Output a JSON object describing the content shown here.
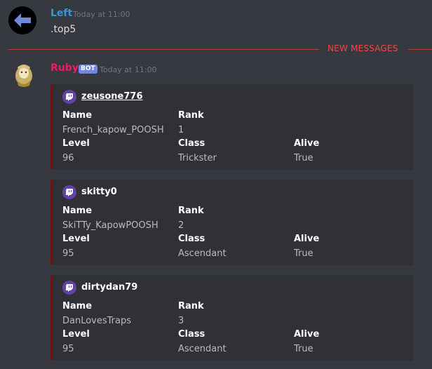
{
  "message1": {
    "author": "Left",
    "timestamp": "Today at 11:00",
    "content": ".top5",
    "author_color": "#3498db"
  },
  "divider": {
    "label": "NEW MESSAGES",
    "color": "#f04747"
  },
  "message2": {
    "author": "Ruby",
    "author_color": "#e91e63",
    "bot_tag": "BOT",
    "timestamp": "Today at 11:00"
  },
  "embeds": [
    {
      "author": "zeusone776",
      "fields": {
        "name_label": "Name",
        "name_value": "French_kapow_POOSH",
        "rank_label": "Rank",
        "rank_value": "1",
        "level_label": "Level",
        "level_value": "96",
        "class_label": "Class",
        "class_value": "Trickster",
        "alive_label": "Alive",
        "alive_value": "True"
      }
    },
    {
      "author": "skitty0",
      "fields": {
        "name_label": "Name",
        "name_value": "SkiTTy_KapowPOOSH",
        "rank_label": "Rank",
        "rank_value": "2",
        "level_label": "Level",
        "level_value": "95",
        "class_label": "Class",
        "class_value": "Ascendant",
        "alive_label": "Alive",
        "alive_value": "True"
      }
    },
    {
      "author": "dirtydan79",
      "fields": {
        "name_label": "Name",
        "name_value": "DanLovesTraps",
        "rank_label": "Rank",
        "rank_value": "3",
        "level_label": "Level",
        "level_value": "95",
        "class_label": "Class",
        "class_value": "Ascendant",
        "alive_label": "Alive",
        "alive_value": "True"
      }
    }
  ],
  "icons": {
    "left_avatar": "arrow-left-icon",
    "ruby_avatar": "ruby-avatar-icon",
    "embed_icon": "twitch-icon"
  }
}
